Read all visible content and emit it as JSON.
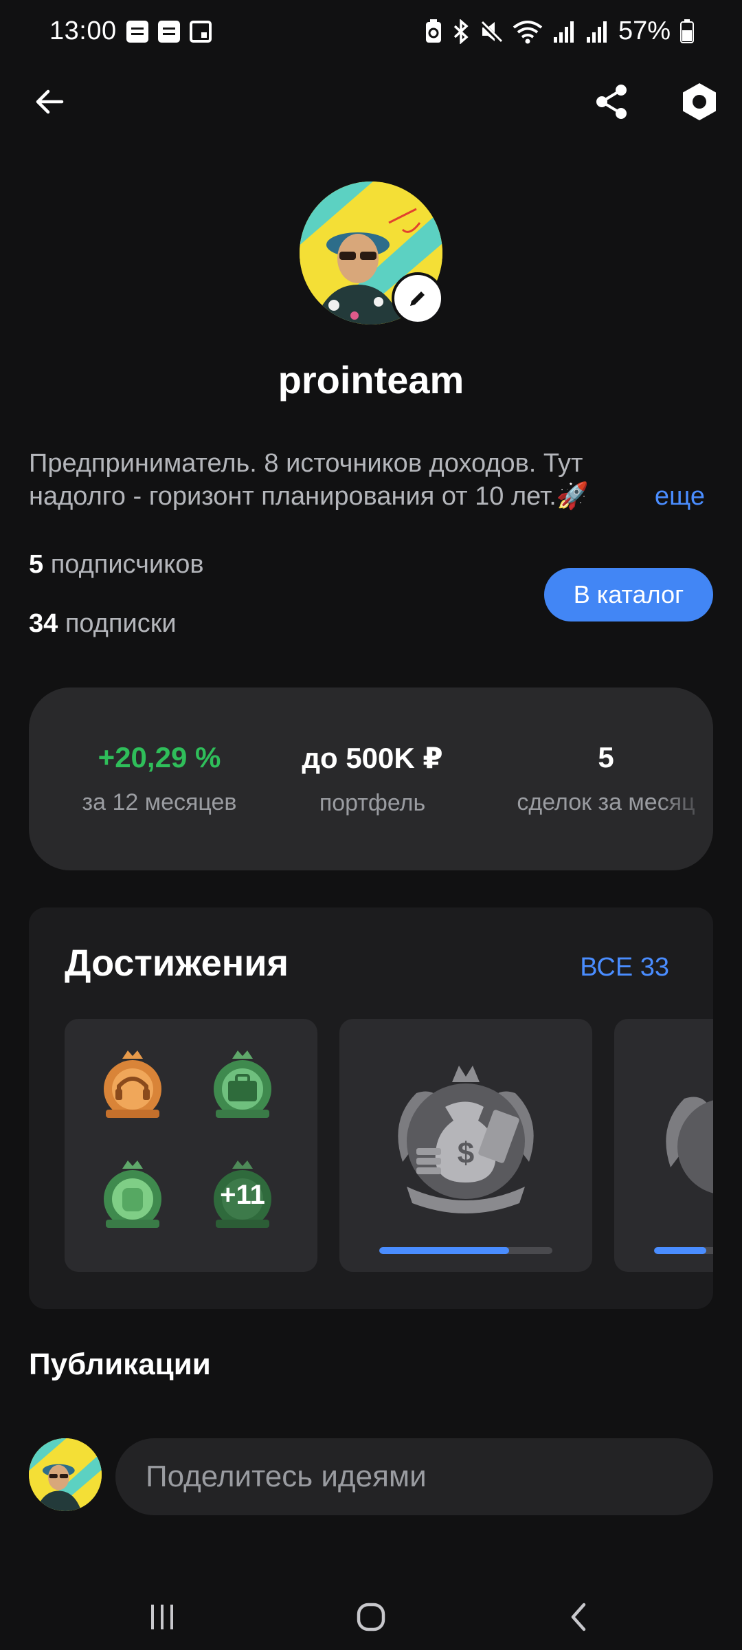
{
  "status_bar": {
    "time": "13:00",
    "battery": "57%",
    "icons": [
      "notes-icon",
      "notes-icon",
      "calendar-icon",
      "battery-saver-icon",
      "bluetooth-icon",
      "mute-icon",
      "wifi-icon",
      "signal-icon",
      "signal-icon",
      "battery-icon"
    ]
  },
  "header": {
    "back_icon": "arrow-left-icon",
    "share_icon": "share-icon",
    "settings_icon": "hexagon-settings-icon"
  },
  "profile": {
    "username": "prointeam",
    "bio_line1": "Предприниматель. 8 источников доходов. Тут",
    "bio_line2": "надолго - горизонт планирования от 10 лет.🚀",
    "bio_more": "еще",
    "followers_count": "5",
    "followers_label": "подписчиков",
    "following_count": "34",
    "following_label": "подписки",
    "catalog_button": "В каталог"
  },
  "stats": [
    {
      "value": "+20,29 %",
      "label": "за 12 месяцев"
    },
    {
      "value": "до 500K ₽",
      "label": "портфель"
    },
    {
      "value": "5",
      "label": "сделок за месяц"
    }
  ],
  "achievements": {
    "title": "Достижения",
    "all_link": "ВСЕ 33",
    "more_count": "+11",
    "tile2_progress": 0.75,
    "tile3_progress": 0.3
  },
  "publications": {
    "title": "Публикации",
    "input_placeholder": "Поделитесь идеями"
  },
  "colors": {
    "background": "#111112",
    "card": "#29292b",
    "accent": "#4286f5",
    "positive": "#2fbe5a",
    "muted_text": "#9a9ca1"
  }
}
